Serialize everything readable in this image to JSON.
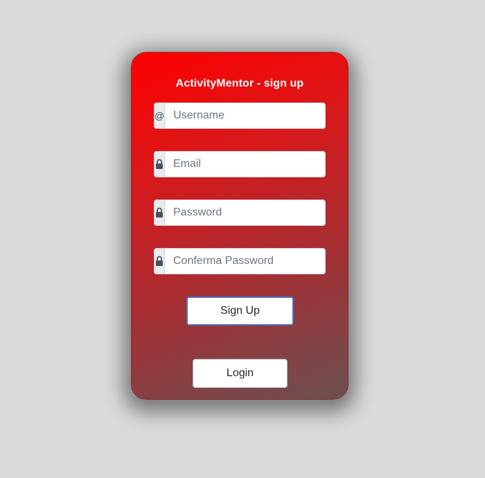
{
  "form": {
    "title": "ActivityMentor - sign up",
    "fields": [
      {
        "icon": "at-icon",
        "addon_text": "@",
        "placeholder": "Username",
        "value": ""
      },
      {
        "icon": "lock-icon",
        "placeholder": "Email",
        "value": ""
      },
      {
        "icon": "lock-icon",
        "placeholder": "Password",
        "value": ""
      },
      {
        "icon": "lock-icon",
        "placeholder": "Conferma Password",
        "value": ""
      }
    ],
    "signup_label": "Sign Up",
    "login_label": "Login"
  },
  "colors": {
    "page_background": "#dadada",
    "card_gradient_start": "#ff0000",
    "card_gradient_end": "#6b5052",
    "signup_border": "#4a6fc7"
  }
}
